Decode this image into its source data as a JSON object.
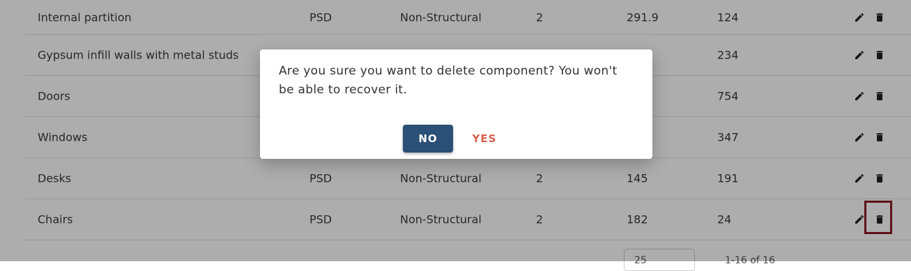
{
  "table": {
    "rows": [
      {
        "name": "Internal partition",
        "type": "PSD",
        "category": "Non-Structural",
        "qty": "2",
        "a": "291.9",
        "b": "124"
      },
      {
        "name": "Gypsum infill walls with metal studs",
        "type": "",
        "category": "",
        "qty": "",
        "a": "",
        "b": "234"
      },
      {
        "name": "Doors",
        "type": "",
        "category": "",
        "qty": "",
        "a": "",
        "b": "754"
      },
      {
        "name": "Windows",
        "type": "",
        "category": "",
        "qty": "",
        "a": "",
        "b": "347"
      },
      {
        "name": "Desks",
        "type": "PSD",
        "category": "Non-Structural",
        "qty": "2",
        "a": "145",
        "b": "191"
      },
      {
        "name": "Chairs",
        "type": "PSD",
        "category": "Non-Structural",
        "qty": "2",
        "a": "182",
        "b": "24"
      }
    ]
  },
  "footer": {
    "rows_per_page": "25",
    "range": "1-16 of 16"
  },
  "dialog": {
    "message": "Are you sure you want to delete component? You won't be able to recover it.",
    "no_label": "NO",
    "yes_label": "YES"
  },
  "icons": {
    "edit": "pencil-icon",
    "delete": "trash-icon"
  },
  "colors": {
    "primary": "#2b4f76",
    "danger": "#d9614c",
    "highlight": "#8b1b24"
  }
}
